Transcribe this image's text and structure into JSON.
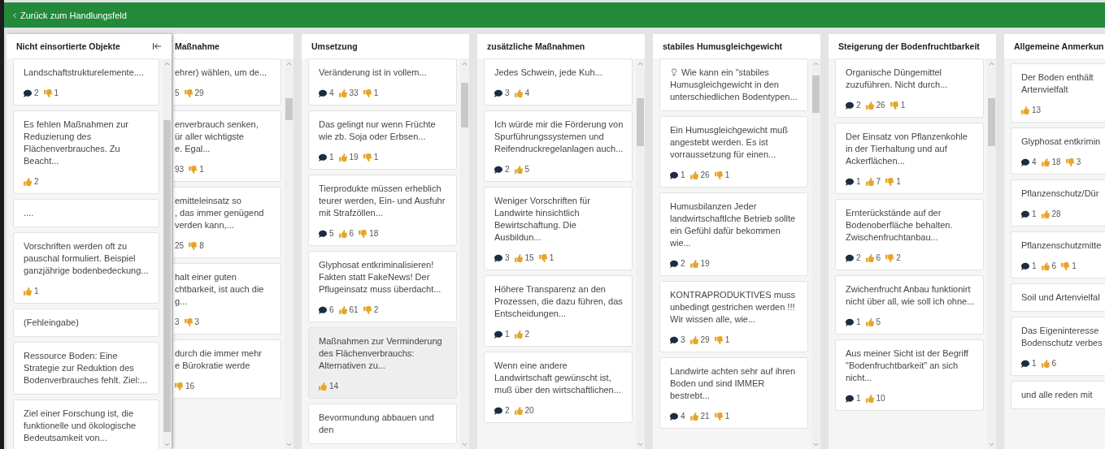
{
  "back_link": {
    "label": "Zurück zum Handlungsfeld"
  },
  "columns": [
    {
      "title": "Nicht einsortierte Objekte",
      "kind": "panel",
      "cards": [
        {
          "text": "Landschaftstrukturelemente....",
          "kind": "note",
          "selected": false,
          "stats": [
            {
              "kind": "comments",
              "count": "2"
            },
            {
              "kind": "dislikes",
              "count": "1"
            }
          ]
        },
        {
          "text": "Es fehlen Maßnahmen zur Reduzierung des Flächenverbrauches. Zu Beacht...",
          "kind": "note",
          "selected": false,
          "stats": [
            {
              "kind": "likes",
              "count": "2"
            }
          ]
        },
        {
          "text": "....",
          "kind": "note",
          "selected": false
        },
        {
          "text": "Vorschriften werden oft zu pauschal formuliert. Beispiel ganzjährige bodenbedeckung...",
          "kind": "note",
          "selected": false,
          "stats": [
            {
              "kind": "likes",
              "count": "1"
            }
          ]
        },
        {
          "text": "(Fehleingabe)",
          "kind": "note",
          "selected": false
        },
        {
          "text": "Ressource Boden: Eine Strategie zur Reduktion des Bodenverbrauches fehlt. Ziel:...",
          "kind": "note",
          "selected": false
        },
        {
          "text": "Ziel einer Forschung ist, die funktionelle und ökologische Bedeutsamkeit von...",
          "kind": "note",
          "selected": false
        }
      ]
    },
    {
      "title": "Maßnahme",
      "kind": "clipped-left",
      "cards": [
        {
          "text": "ehrer) wählen, um de...",
          "kind": "note",
          "selected": false,
          "stats": [
            {
              "kind": "cut",
              "count": "5"
            },
            {
              "kind": "dislikes",
              "count": "29"
            }
          ]
        },
        {
          "text": "enverbrauch senken,\nür aller wichtigste\ne. Egal...",
          "kind": "note",
          "selected": false,
          "stats": [
            {
              "kind": "cut",
              "count": "93"
            },
            {
              "kind": "dislikes",
              "count": "1"
            }
          ]
        },
        {
          "text": "emitteleinsatz so\n, das immer genügend\nverden kann,...",
          "kind": "note",
          "selected": false,
          "stats": [
            {
              "kind": "cut",
              "count": "25"
            },
            {
              "kind": "dislikes",
              "count": "8"
            }
          ]
        },
        {
          "text": "halt einer guten\nchtbarkeit, ist auch die\ng...",
          "kind": "note",
          "selected": false,
          "stats": [
            {
              "kind": "cut",
              "count": "3"
            },
            {
              "kind": "dislikes",
              "count": "3"
            }
          ]
        },
        {
          "text": "durch die immer mehr\ne Bürokratie werde",
          "kind": "note",
          "selected": false,
          "stats": [
            {
              "kind": "dislikes",
              "count": "16"
            }
          ]
        }
      ]
    },
    {
      "title": "Umsetzung",
      "kind": "normal",
      "cards": [
        {
          "text": "Veränderung ist in vollem...",
          "kind": "note",
          "selected": false,
          "stats": [
            {
              "kind": "comments",
              "count": "4"
            },
            {
              "kind": "likes",
              "count": "33"
            },
            {
              "kind": "dislikes",
              "count": "1"
            }
          ]
        },
        {
          "text": "Das gelingt nur wenn Früchte wie zb. Soja oder Erbsen...",
          "kind": "note",
          "selected": false,
          "stats": [
            {
              "kind": "comments",
              "count": "1"
            },
            {
              "kind": "likes",
              "count": "19"
            },
            {
              "kind": "dislikes",
              "count": "1"
            }
          ]
        },
        {
          "text": "Tierprodukte müssen erheblich teurer werden, Ein- und Ausfuhr mit Strafzöllen...",
          "kind": "note",
          "selected": false,
          "stats": [
            {
              "kind": "comments",
              "count": "5"
            },
            {
              "kind": "likes",
              "count": "6"
            },
            {
              "kind": "dislikes",
              "count": "18"
            }
          ]
        },
        {
          "text": "Glyphosat entkriminalisieren! Fakten statt FakeNews! Der Pflugeinsatz muss überdacht...",
          "kind": "note",
          "selected": false,
          "stats": [
            {
              "kind": "comments",
              "count": "6"
            },
            {
              "kind": "likes",
              "count": "61"
            },
            {
              "kind": "dislikes",
              "count": "2"
            }
          ]
        },
        {
          "text": "Maßnahmen zur Verminderung des Flächenverbrauchs: Alternativen zu...",
          "kind": "note",
          "selected": true,
          "stats": [
            {
              "kind": "likes",
              "count": "14"
            }
          ]
        },
        {
          "text": "Bevormundung abbauen und den",
          "kind": "note",
          "selected": false
        }
      ]
    },
    {
      "title": "zusätzliche Maßnahmen",
      "kind": "normal",
      "cards": [
        {
          "text": "Jedes Schwein, jede Kuh...",
          "kind": "note",
          "selected": false,
          "stats": [
            {
              "kind": "comments",
              "count": "3"
            },
            {
              "kind": "likes",
              "count": "4"
            }
          ]
        },
        {
          "text": "Ich würde mir die Förderung von Spurführungssystemen und Reifendruckregelanlagen auch...",
          "kind": "note",
          "selected": false,
          "stats": [
            {
              "kind": "comments",
              "count": "2"
            },
            {
              "kind": "likes",
              "count": "5"
            }
          ]
        },
        {
          "text": "Weniger Vorschriften für Landwirte hinsichtlich Bewirtschaftung. Die Ausbildun...",
          "kind": "note",
          "selected": false,
          "stats": [
            {
              "kind": "comments",
              "count": "3"
            },
            {
              "kind": "likes",
              "count": "15"
            },
            {
              "kind": "dislikes",
              "count": "1"
            }
          ]
        },
        {
          "text": "Höhere Transparenz an den Prozessen, die dazu führen, das Entscheidungen...",
          "kind": "note",
          "selected": false,
          "stats": [
            {
              "kind": "comments",
              "count": "1"
            },
            {
              "kind": "likes",
              "count": "2"
            }
          ]
        },
        {
          "text": "Wenn eine andere Landwirtschaft gewünscht ist, muß über den wirtschaftlichen...",
          "kind": "note",
          "selected": false,
          "stats": [
            {
              "kind": "comments",
              "count": "2"
            },
            {
              "kind": "likes",
              "count": "20"
            }
          ]
        }
      ]
    },
    {
      "title": "stabiles Humusgleichgewicht",
      "kind": "normal",
      "cards": [
        {
          "text": "Wie kann ein \"stabiles Humusgleichgewicht in den unterschiedlichen Bodentypen...",
          "kind": "question",
          "selected": false
        },
        {
          "text": "Ein Humusgleichgewicht muß angestebt werden. Es ist vorraussetzung für einen...",
          "kind": "note",
          "selected": false,
          "stats": [
            {
              "kind": "comments",
              "count": "1"
            },
            {
              "kind": "likes",
              "count": "26"
            },
            {
              "kind": "dislikes",
              "count": "1"
            }
          ]
        },
        {
          "text": "Humusbilanzen Jeder landwirtschaftlche Betrieb sollte ein Gefühl dafür bekommen wie...",
          "kind": "note",
          "selected": false,
          "stats": [
            {
              "kind": "comments",
              "count": "2"
            },
            {
              "kind": "likes",
              "count": "19"
            }
          ]
        },
        {
          "text": "KONTRAPRODUKTIVES muss unbedingt gestrichen werden !!! Wir wissen alle, wie...",
          "kind": "note",
          "selected": false,
          "stats": [
            {
              "kind": "comments",
              "count": "3"
            },
            {
              "kind": "likes",
              "count": "29"
            },
            {
              "kind": "dislikes",
              "count": "1"
            }
          ]
        },
        {
          "text": "Landwirte achten sehr auf ihren Boden und sind IMMER bestrebt...",
          "kind": "note",
          "selected": false,
          "stats": [
            {
              "kind": "comments",
              "count": "4"
            },
            {
              "kind": "likes",
              "count": "21"
            },
            {
              "kind": "dislikes",
              "count": "1"
            }
          ]
        }
      ]
    },
    {
      "title": "Steigerung der Bodenfruchtbarkeit",
      "kind": "normal",
      "cards": [
        {
          "text": "Organische Düngemittel zuzuführen. Nicht durch...",
          "kind": "note",
          "selected": false,
          "stats": [
            {
              "kind": "comments",
              "count": "2"
            },
            {
              "kind": "likes",
              "count": "26"
            },
            {
              "kind": "dislikes",
              "count": "1"
            }
          ]
        },
        {
          "text": "Der Einsatz von Pflanzenkohle in der Tierhaltung und auf Ackerflächen...",
          "kind": "note",
          "selected": false,
          "stats": [
            {
              "kind": "comments",
              "count": "1"
            },
            {
              "kind": "likes",
              "count": "7"
            },
            {
              "kind": "dislikes",
              "count": "1"
            }
          ]
        },
        {
          "text": "Ernterückstände auf der Bodenoberfläche behalten. Zwischenfruchtanbau...",
          "kind": "note",
          "selected": false,
          "stats": [
            {
              "kind": "comments",
              "count": "2"
            },
            {
              "kind": "likes",
              "count": "6"
            },
            {
              "kind": "dislikes",
              "count": "2"
            }
          ]
        },
        {
          "text": "Zwichenfrucht Anbau funktionirt nicht über all, wie soll ich ohne...",
          "kind": "note",
          "selected": false,
          "stats": [
            {
              "kind": "comments",
              "count": "1"
            },
            {
              "kind": "likes",
              "count": "5"
            }
          ]
        },
        {
          "text": "Aus meiner Sicht ist der Begriff \"Bodenfruchtbarkeit\" an sich nicht...",
          "kind": "note",
          "selected": false,
          "stats": [
            {
              "kind": "comments",
              "count": "1"
            },
            {
              "kind": "likes",
              "count": "10"
            }
          ]
        }
      ]
    },
    {
      "title": "Allgemeine Anmerkun",
      "kind": "clipped-right",
      "cards": [
        {
          "text": "Der Boden enthält\nArtenvielfalt",
          "kind": "note",
          "selected": false,
          "stats": [
            {
              "kind": "likes",
              "count": "13"
            }
          ]
        },
        {
          "text": "Glyphosat entkrimin",
          "kind": "note",
          "selected": false,
          "stats": [
            {
              "kind": "comments",
              "count": "4"
            },
            {
              "kind": "likes",
              "count": "18"
            },
            {
              "kind": "dislikes",
              "count": "3"
            }
          ]
        },
        {
          "text": "Pflanzenschutz/Dür",
          "kind": "note",
          "selected": false,
          "stats": [
            {
              "kind": "comments",
              "count": "1"
            },
            {
              "kind": "likes",
              "count": "28"
            }
          ]
        },
        {
          "text": "Pflanzenschutzmitte",
          "kind": "note",
          "selected": false,
          "stats": [
            {
              "kind": "comments",
              "count": "1"
            },
            {
              "kind": "likes",
              "count": "6"
            },
            {
              "kind": "dislikes",
              "count": "1"
            }
          ]
        },
        {
          "text": "Soil und Artenvielfal",
          "kind": "note",
          "selected": false
        },
        {
          "text": "Das Eigeninteresse\nBodenschutz verbes",
          "kind": "note",
          "selected": false,
          "stats": [
            {
              "kind": "comments",
              "count": "1"
            },
            {
              "kind": "likes",
              "count": "6"
            }
          ]
        },
        {
          "text": "und alle reden mit",
          "kind": "note",
          "selected": false
        }
      ]
    }
  ]
}
